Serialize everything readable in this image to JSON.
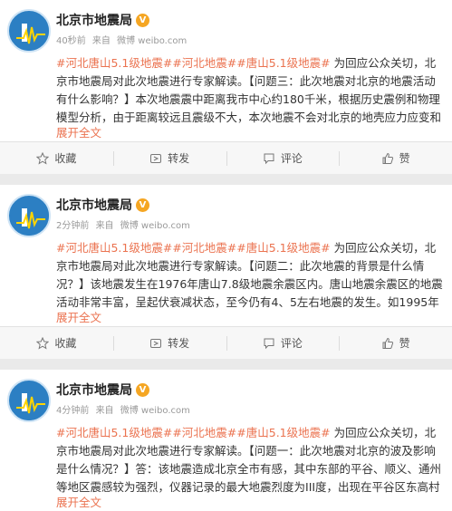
{
  "account": {
    "name": "北京市地震局",
    "verified_badge": "V",
    "source_prefix": "来自",
    "source": "微博 weibo.com"
  },
  "actions": {
    "favorite": "收藏",
    "repost": "转发",
    "comment": "评论",
    "like": "赞"
  },
  "expand_label": "展开全文",
  "posts": [
    {
      "time": "40秒前",
      "tags": [
        "#河北唐山5.1级地震#",
        "#河北地震#",
        "#唐山5.1级地震#"
      ],
      "body": "为回应公众关切，北京市地震局对此次地震进行专家解读。【问题三：此次地震对北京的地震活动有什么影响？】本次地震震中距离我市中心约180千米，根据历史震例和物理模型分析，由于距离较远且震级不大，本次地震不会对北京的地壳应力应变和地震活动产生"
    },
    {
      "time": "2分钟前",
      "tags": [
        "#河北唐山5.1级地震#",
        "#河北地震#",
        "#唐山5.1级地震#"
      ],
      "body": "为回应公众关切，北京市地震局对此次地震进行专家解读。【问题二：此次地震的背景是什么情况？】该地震发生在1976年唐山7.8级地震余震区内。唐山地震余震区的地震活动非常丰富，呈起伏衰减状态，至今仍有4、5左右地震的发生。如1995年10月6日河北唐山"
    },
    {
      "time": "4分钟前",
      "tags": [
        "#河北唐山5.1级地震#",
        "#河北地震#",
        "#唐山5.1级地震#"
      ],
      "body": "为回应公众关切，北京市地震局对此次地震进行专家解读。【问题一：此次地震对北京的波及影响是什么情况？】答：该地震造成北京全市有感，其中东部的平谷、顺义、通州等地区震感较为强烈，仪器记录的最大地震烈度为III度，出现在平谷区东高村镇、马昌营"
    }
  ],
  "colors": {
    "tag": "#eb7350",
    "avatar": "#2c7fc3",
    "badge": "#f5a623"
  }
}
